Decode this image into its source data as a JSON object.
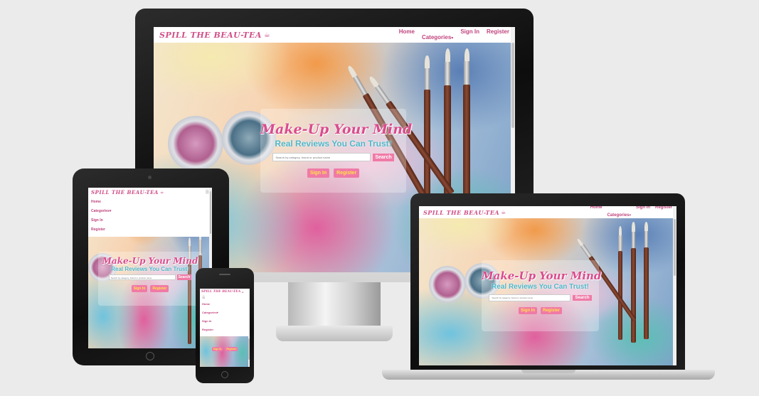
{
  "site": {
    "brand": "SPILL THE BEAU-TEA",
    "brand_icon": "teapot-icon",
    "nav": [
      "Home",
      "Categories",
      "Sign In",
      "Register"
    ],
    "hero_title": "Make-Up Your Mind",
    "hero_subtitle": "Real Reviews You Can Trust!",
    "search_placeholder": "Search by category, brand or product name",
    "search_button": "Search",
    "cta_signin": "Sign In",
    "cta_register": "Register",
    "dropdown_caret": "▾",
    "hamburger": "☰"
  },
  "colors": {
    "brand_pink": "#d0508a",
    "button_pink": "#f07aa6",
    "button_text_yellow": "#ffe14a",
    "subtitle_teal": "#4fb7c9",
    "page_bg": "#ebebeb"
  },
  "devices": [
    "desktop-monitor",
    "tablet",
    "laptop",
    "phone"
  ]
}
